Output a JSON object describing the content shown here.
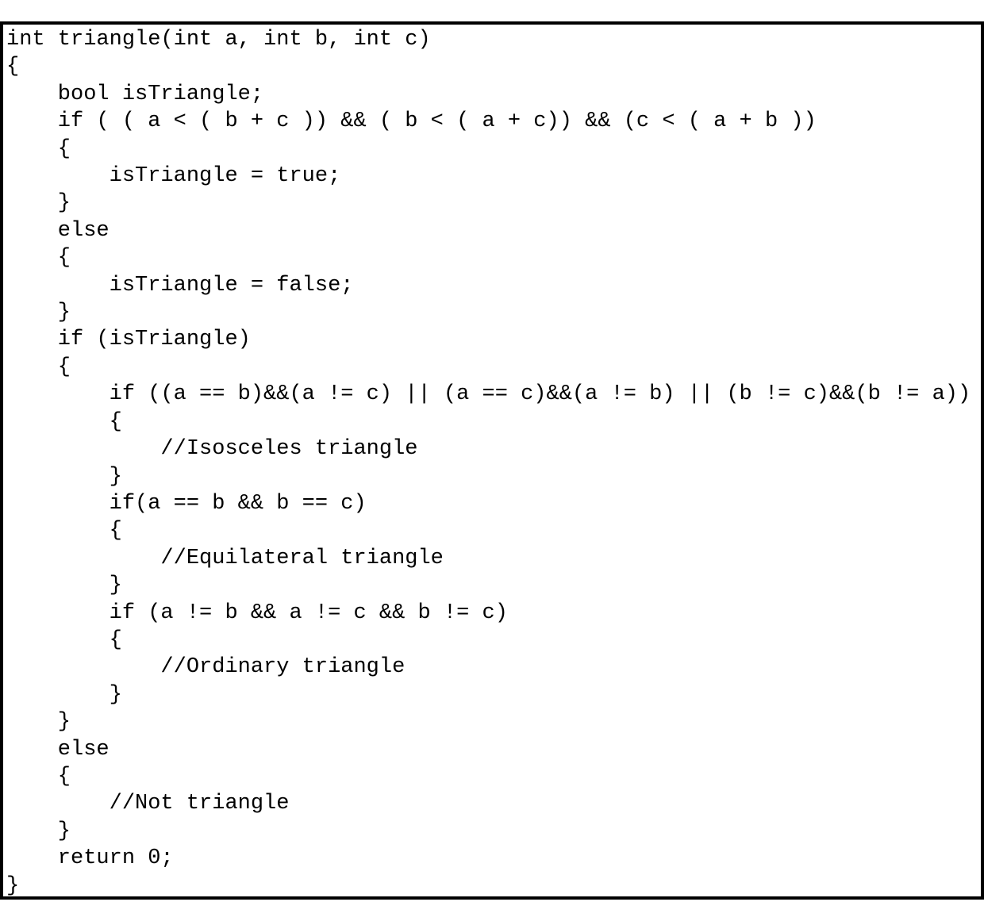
{
  "code": {
    "lines": [
      "int triangle(int a, int b, int c)",
      "{",
      "    bool isTriangle;",
      "    if ( ( a < ( b + c )) && ( b < ( a + c)) && (c < ( a + b ))",
      "    {",
      "        isTriangle = true;",
      "    }",
      "    else",
      "    {",
      "        isTriangle = false;",
      "    }",
      "    if (isTriangle)",
      "    {",
      "        if ((a == b)&&(a != c) || (a == c)&&(a != b) || (b != c)&&(b != a))",
      "        {",
      "            //Isosceles triangle",
      "        }",
      "        if(a == b && b == c)",
      "        {",
      "            //Equilateral triangle",
      "        }",
      "        if (a != b && a != c && b != c)",
      "        {",
      "            //Ordinary triangle",
      "        }",
      "    }",
      "    else",
      "    {",
      "        //Not triangle",
      "    }",
      "    return 0;",
      "}"
    ]
  }
}
